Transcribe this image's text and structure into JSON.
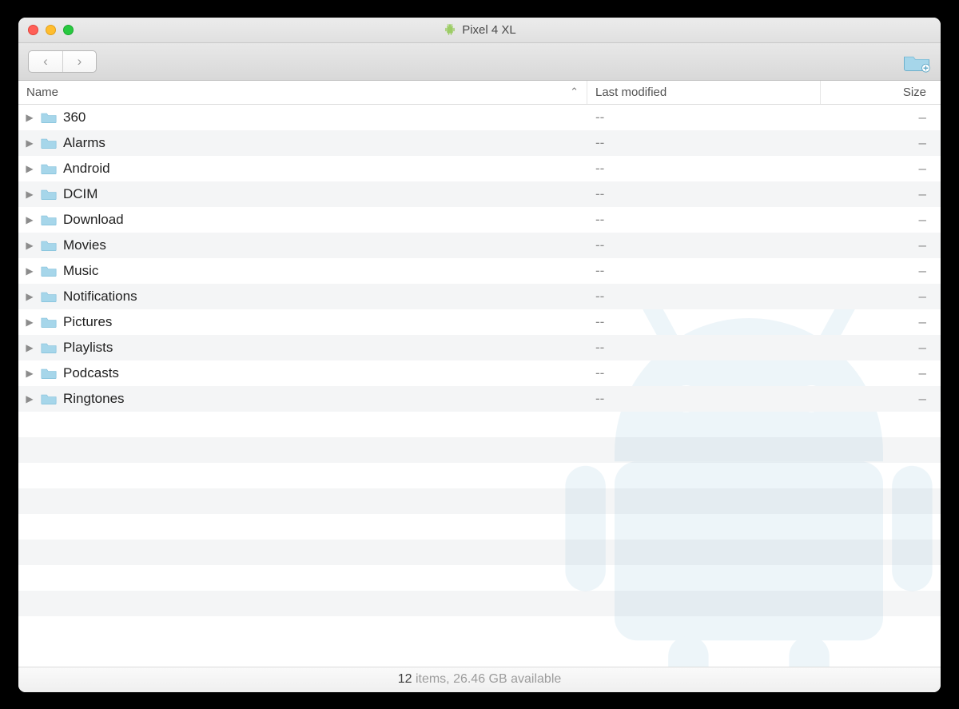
{
  "window": {
    "title": "Pixel 4 XL",
    "traffic": {
      "close": "#ff5f57",
      "minimize": "#ffbd2e",
      "zoom": "#28c940"
    }
  },
  "toolbar": {
    "back_glyph": "‹",
    "forward_glyph": "›",
    "newfolder_color": "#9fd0e6"
  },
  "columns": {
    "name": "Name",
    "modified": "Last modified",
    "size": "Size",
    "sort_asc_glyph": "⌃"
  },
  "list": {
    "items": [
      {
        "name": "360",
        "modified": "--",
        "size": "–"
      },
      {
        "name": "Alarms",
        "modified": "--",
        "size": "–"
      },
      {
        "name": "Android",
        "modified": "--",
        "size": "–"
      },
      {
        "name": "DCIM",
        "modified": "--",
        "size": "–"
      },
      {
        "name": "Download",
        "modified": "--",
        "size": "–"
      },
      {
        "name": "Movies",
        "modified": "--",
        "size": "–"
      },
      {
        "name": "Music",
        "modified": "--",
        "size": "–"
      },
      {
        "name": "Notifications",
        "modified": "--",
        "size": "–"
      },
      {
        "name": "Pictures",
        "modified": "--",
        "size": "–"
      },
      {
        "name": "Playlists",
        "modified": "--",
        "size": "–"
      },
      {
        "name": "Podcasts",
        "modified": "--",
        "size": "–"
      },
      {
        "name": "Ringtones",
        "modified": "--",
        "size": "–"
      }
    ],
    "disclosure_glyph": "▶",
    "empty_stripe_count": 9
  },
  "status": {
    "count": "12",
    "count_suffix": " items, ",
    "free": "26.46 GB",
    "free_suffix": " available"
  }
}
